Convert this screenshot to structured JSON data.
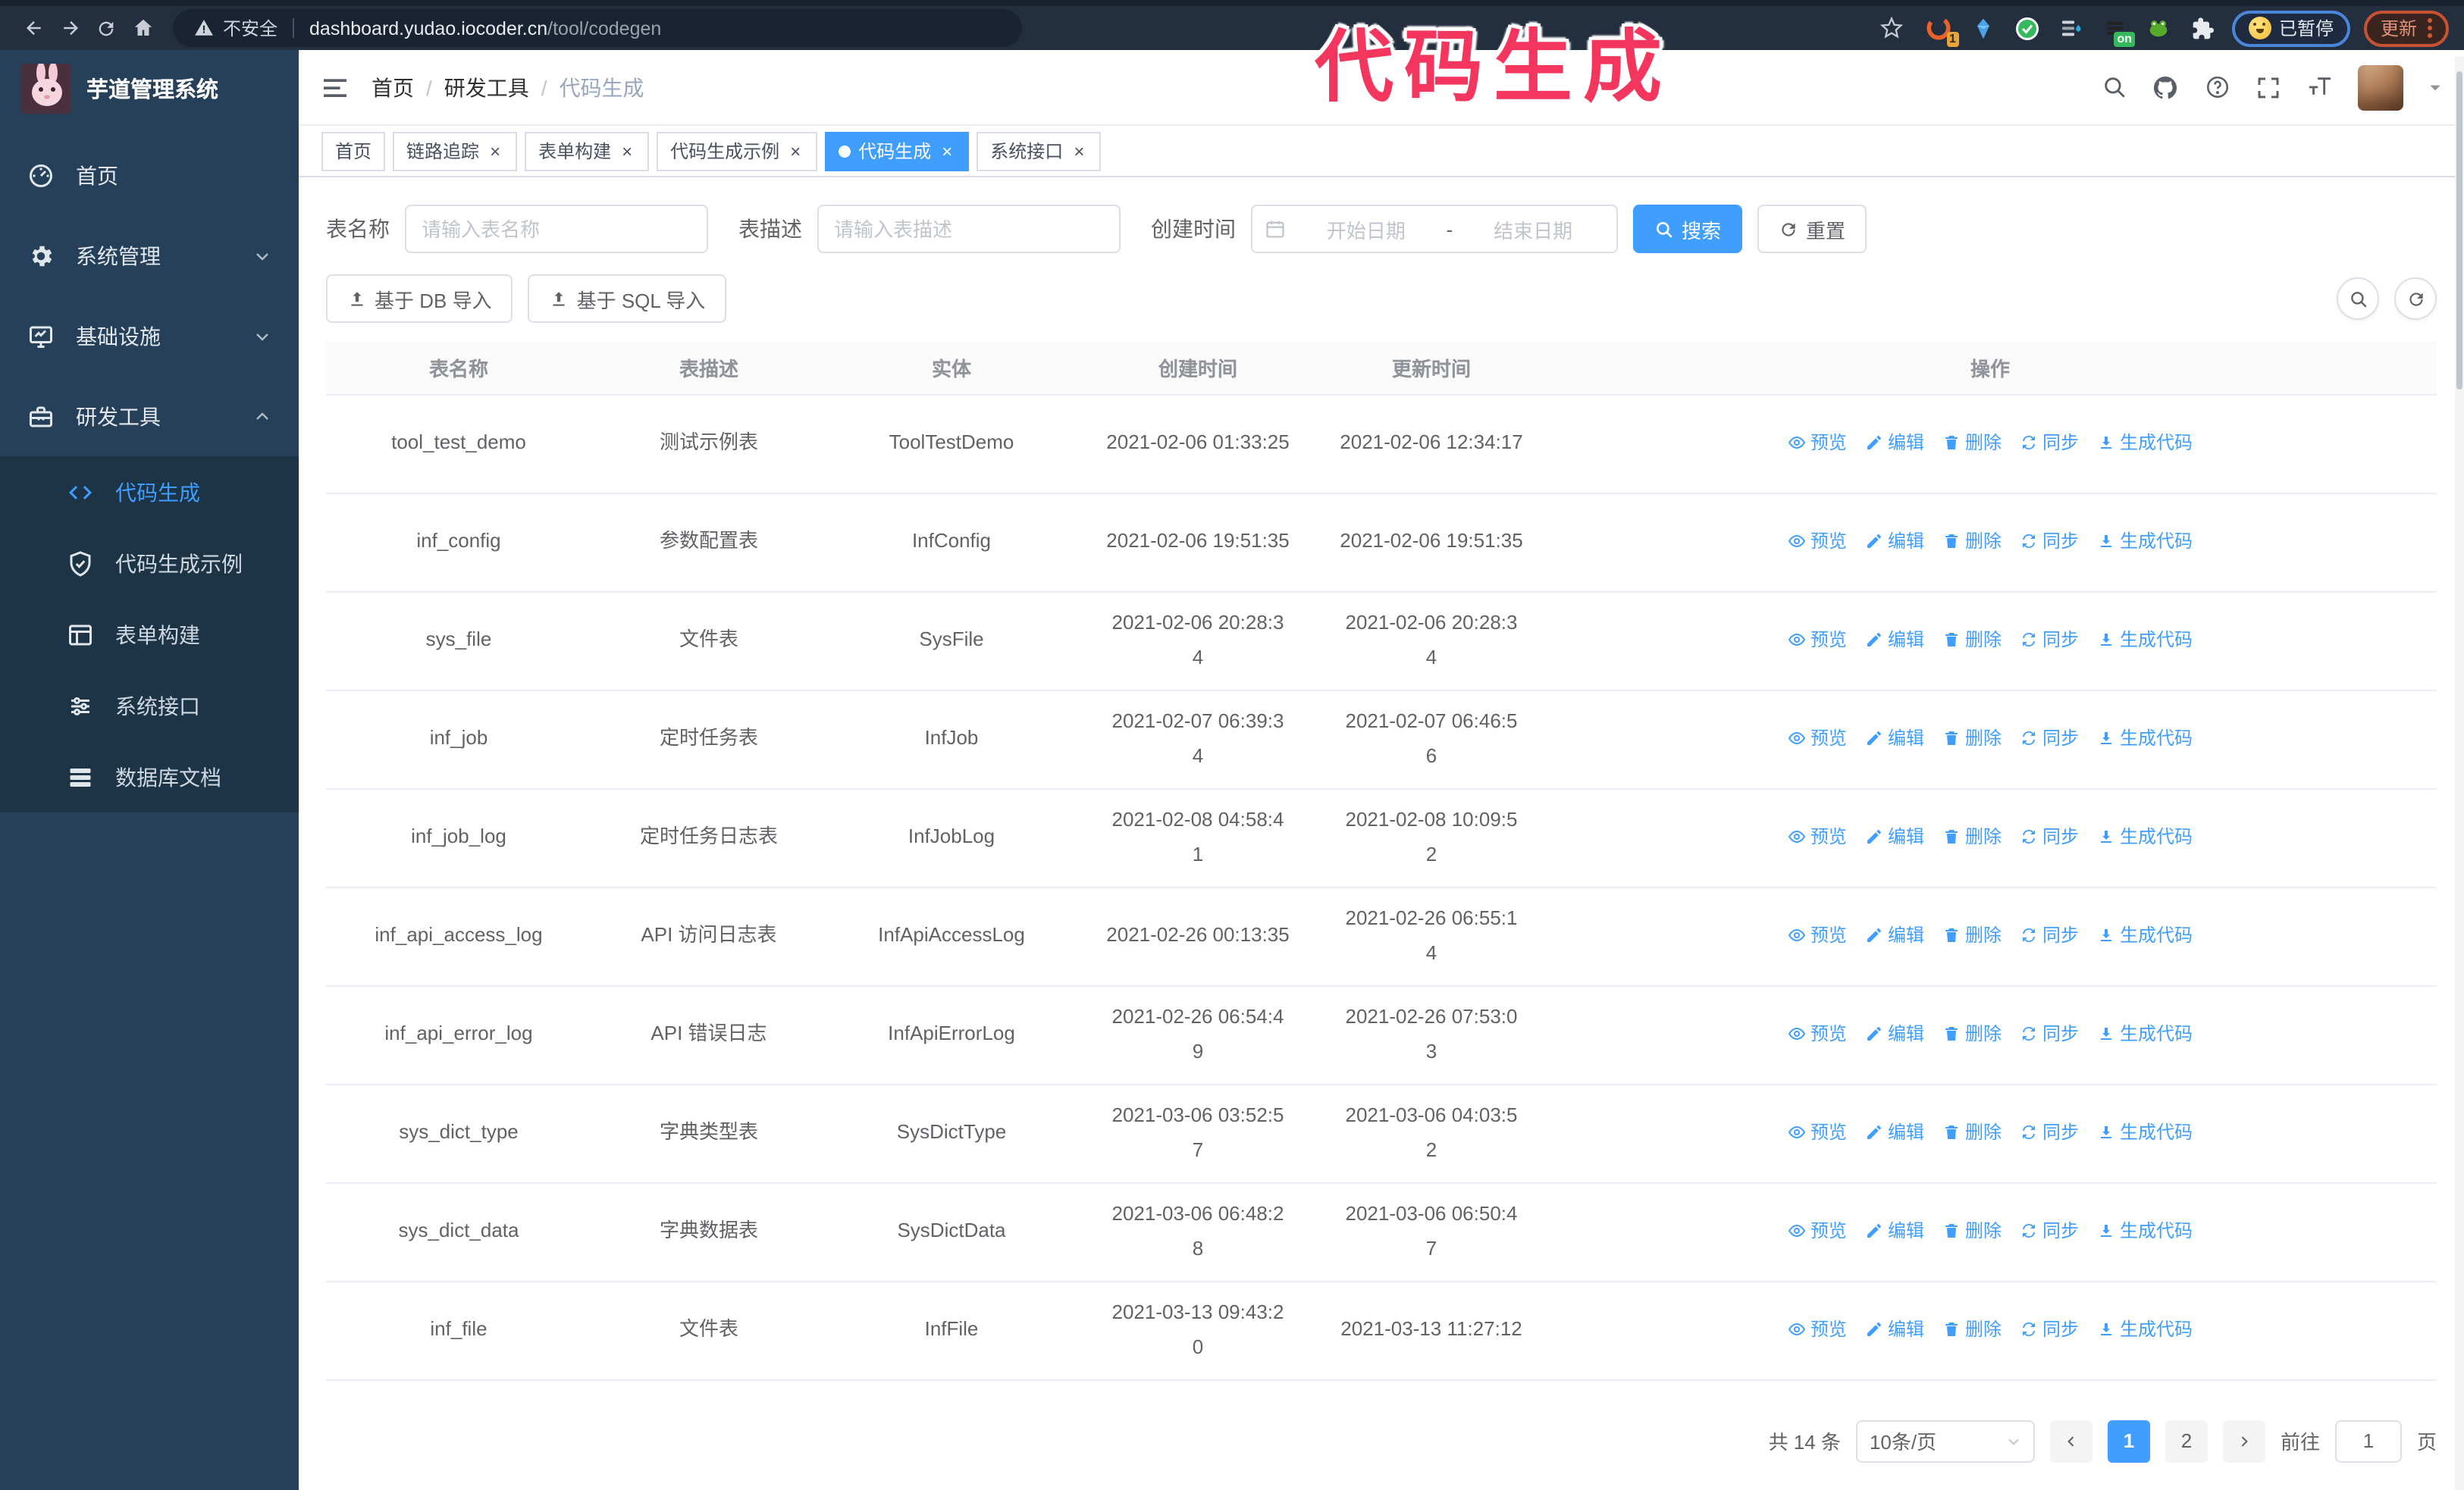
{
  "browser": {
    "security_label": "不安全",
    "url_host": "dashboard.yudao.iocoder.cn",
    "url_path": "/tool/codegen",
    "ext_badge_count": "1",
    "ext_badge_on": "on",
    "paused_badge": "已暂停",
    "update_button": "更新"
  },
  "annotation": {
    "text": "代码生成",
    "color": "#f4365e"
  },
  "sidebar": {
    "title": "芋道管理系统",
    "items": [
      {
        "label": "首页",
        "icon": "dashboard-icon"
      },
      {
        "label": "系统管理",
        "icon": "gear-icon",
        "arrow": "down"
      },
      {
        "label": "基础设施",
        "icon": "monitor-icon",
        "arrow": "down"
      },
      {
        "label": "研发工具",
        "icon": "toolbox-icon",
        "arrow": "up"
      }
    ],
    "sub_items": [
      {
        "label": "代码生成",
        "icon": "code-icon",
        "active": true
      },
      {
        "label": "代码生成示例",
        "icon": "shield-check-icon",
        "active": false
      },
      {
        "label": "表单构建",
        "icon": "form-icon",
        "active": false
      },
      {
        "label": "系统接口",
        "icon": "sliders-icon",
        "active": false
      },
      {
        "label": "数据库文档",
        "icon": "database-icon",
        "active": false
      }
    ]
  },
  "header": {
    "breadcrumb": [
      "首页",
      "研发工具",
      "代码生成"
    ]
  },
  "tags": [
    {
      "label": "首页",
      "closable": false,
      "active": false
    },
    {
      "label": "链路追踪",
      "closable": true,
      "active": false
    },
    {
      "label": "表单构建",
      "closable": true,
      "active": false
    },
    {
      "label": "代码生成示例",
      "closable": true,
      "active": false
    },
    {
      "label": "代码生成",
      "closable": true,
      "active": true
    },
    {
      "label": "系统接口",
      "closable": true,
      "active": false
    }
  ],
  "filters": {
    "table_name_label": "表名称",
    "table_name_placeholder": "请输入表名称",
    "table_desc_label": "表描述",
    "table_desc_placeholder": "请输入表描述",
    "create_time_label": "创建时间",
    "start_placeholder": "开始日期",
    "range_separator": "-",
    "end_placeholder": "结束日期",
    "search_label": "搜索",
    "reset_label": "重置"
  },
  "toolbar": {
    "import_db_label": "基于 DB 导入",
    "import_sql_label": "基于 SQL 导入"
  },
  "table": {
    "columns": [
      "表名称",
      "表描述",
      "实体",
      "创建时间",
      "更新时间",
      "操作"
    ],
    "action_labels": {
      "preview": "预览",
      "edit": "编辑",
      "delete": "删除",
      "sync": "同步",
      "generate": "生成代码"
    },
    "rows": [
      {
        "name": "tool_test_demo",
        "desc": "测试示例表",
        "entity": "ToolTestDemo",
        "created": "2021-02-06 01:33:25",
        "updated": "2021-02-06 12:34:17"
      },
      {
        "name": "inf_config",
        "desc": "参数配置表",
        "entity": "InfConfig",
        "created": "2021-02-06 19:51:35",
        "updated": "2021-02-06 19:51:35"
      },
      {
        "name": "sys_file",
        "desc": "文件表",
        "entity": "SysFile",
        "created": "2021-02-06 20:28:3\n4",
        "updated": "2021-02-06 20:28:3\n4"
      },
      {
        "name": "inf_job",
        "desc": "定时任务表",
        "entity": "InfJob",
        "created": "2021-02-07 06:39:3\n4",
        "updated": "2021-02-07 06:46:5\n6"
      },
      {
        "name": "inf_job_log",
        "desc": "定时任务日志表",
        "entity": "InfJobLog",
        "created": "2021-02-08 04:58:4\n1",
        "updated": "2021-02-08 10:09:5\n2"
      },
      {
        "name": "inf_api_access_log",
        "desc": "API 访问日志表",
        "entity": "InfApiAccessLog",
        "created": "2021-02-26 00:13:35",
        "updated": "2021-02-26 06:55:1\n4"
      },
      {
        "name": "inf_api_error_log",
        "desc": "API 错误日志",
        "entity": "InfApiErrorLog",
        "created": "2021-02-26 06:54:4\n9",
        "updated": "2021-02-26 07:53:0\n3"
      },
      {
        "name": "sys_dict_type",
        "desc": "字典类型表",
        "entity": "SysDictType",
        "created": "2021-03-06 03:52:5\n7",
        "updated": "2021-03-06 04:03:5\n2"
      },
      {
        "name": "sys_dict_data",
        "desc": "字典数据表",
        "entity": "SysDictData",
        "created": "2021-03-06 06:48:2\n8",
        "updated": "2021-03-06 06:50:4\n7"
      },
      {
        "name": "inf_file",
        "desc": "文件表",
        "entity": "InfFile",
        "created": "2021-03-13 09:43:2\n0",
        "updated": "2021-03-13 11:27:12"
      }
    ]
  },
  "pagination": {
    "total_text": "共 14 条",
    "page_size": "10条/页",
    "pages": [
      "1",
      "2"
    ],
    "active_page": "1",
    "goto_label": "前往",
    "goto_value": "1",
    "page_suffix": "页"
  },
  "colors": {
    "primary": "#409EFF",
    "sidebar_bg": "#254058",
    "submenu_bg": "#1d3346",
    "annotation": "#f4365e"
  }
}
